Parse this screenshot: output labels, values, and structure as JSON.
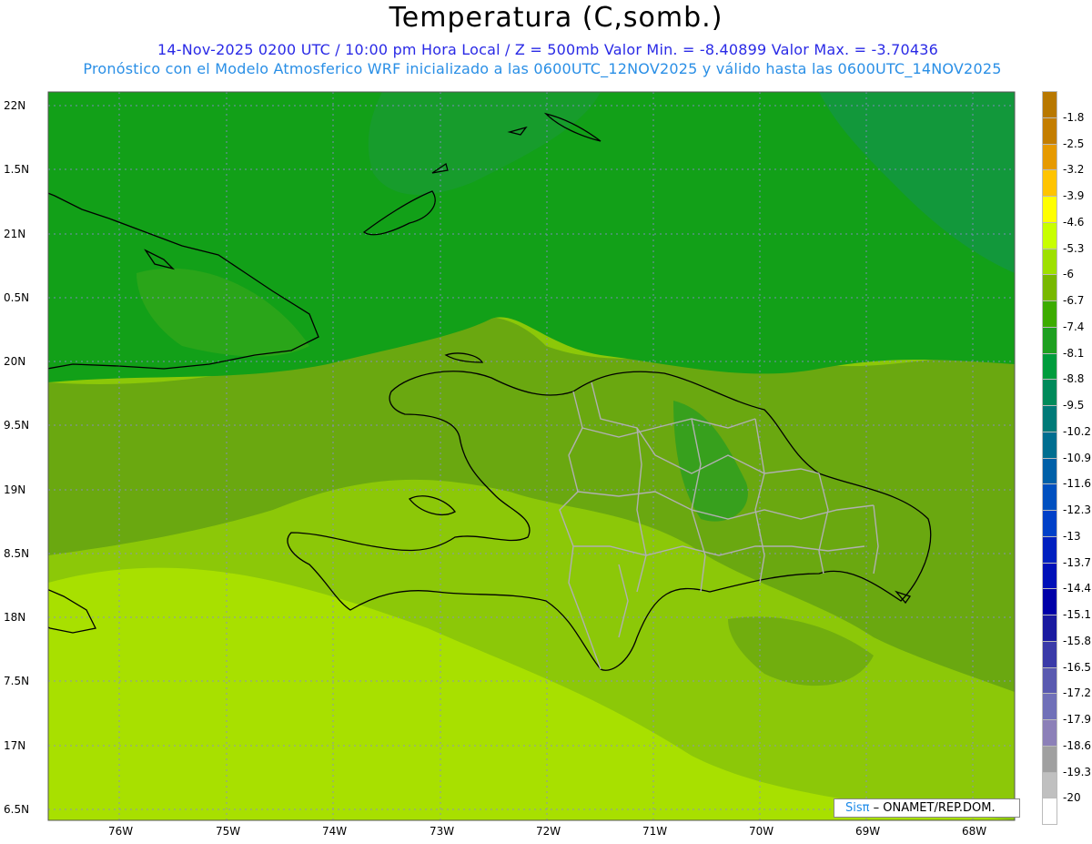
{
  "header": {
    "title": "Temperatura (C,somb.)",
    "line1": "14-Nov-2025  0200 UTC / 10:00 pm Hora Local / Z = 500mb  Valor Min. = -8.40899  Valor Max. = -3.70436",
    "line2": "Pronóstico con el Modelo Atmosferico WRF inicializado a las 0600UTC_12NOV2025 y válido hasta las  0600UTC_14NOV2025"
  },
  "lat_labels": [
    "22N",
    "1.5N",
    "21N",
    "0.5N",
    "20N",
    "9.5N",
    "19N",
    "8.5N",
    "18N",
    "7.5N",
    "17N",
    "6.5N"
  ],
  "lon_labels": [
    "76W",
    "75W",
    "74W",
    "73W",
    "72W",
    "71W",
    "70W",
    "69W",
    "68W"
  ],
  "colorbar": {
    "labels": [
      "-1.8",
      "-2.5",
      "-3.2",
      "-3.9",
      "-4.6",
      "-5.3",
      "-6",
      "-6.7",
      "-7.4",
      "-8.1",
      "-8.8",
      "-9.5",
      "-10.2",
      "-10.9",
      "-11.6",
      "-12.3",
      "-13",
      "-13.7",
      "-14.4",
      "-15.1",
      "-15.8",
      "-16.5",
      "-17.2",
      "-17.9",
      "-18.6",
      "-19.3",
      "-20"
    ],
    "colors": [
      "#c47e00",
      "#e69a00",
      "#ffc400",
      "#ffff00",
      "#c8ff00",
      "#9ee000",
      "#78b800",
      "#3cac00",
      "#1ea020",
      "#009c3c",
      "#008a5a",
      "#007a78",
      "#006e90",
      "#0060a8",
      "#0050c0",
      "#0040c8",
      "#0020c0",
      "#0010b8",
      "#0000a8",
      "#1a1aa0",
      "#3a3aa8",
      "#5a5ab0",
      "#7070b8",
      "#8c80b8",
      "#a0a0a0",
      "#c0c0c0",
      "#ffffff"
    ]
  },
  "field_colors": {
    "ocean_north": "#12a018",
    "ocean_north_dark": "#0e9a30",
    "mid_band": "#4aaa1c",
    "land": "#6aa810",
    "south_band": "#8cc808",
    "south_light": "#a8e000"
  },
  "credit": {
    "logo": "Sisπ",
    "text": " – ONAMET/REP.DOM."
  }
}
